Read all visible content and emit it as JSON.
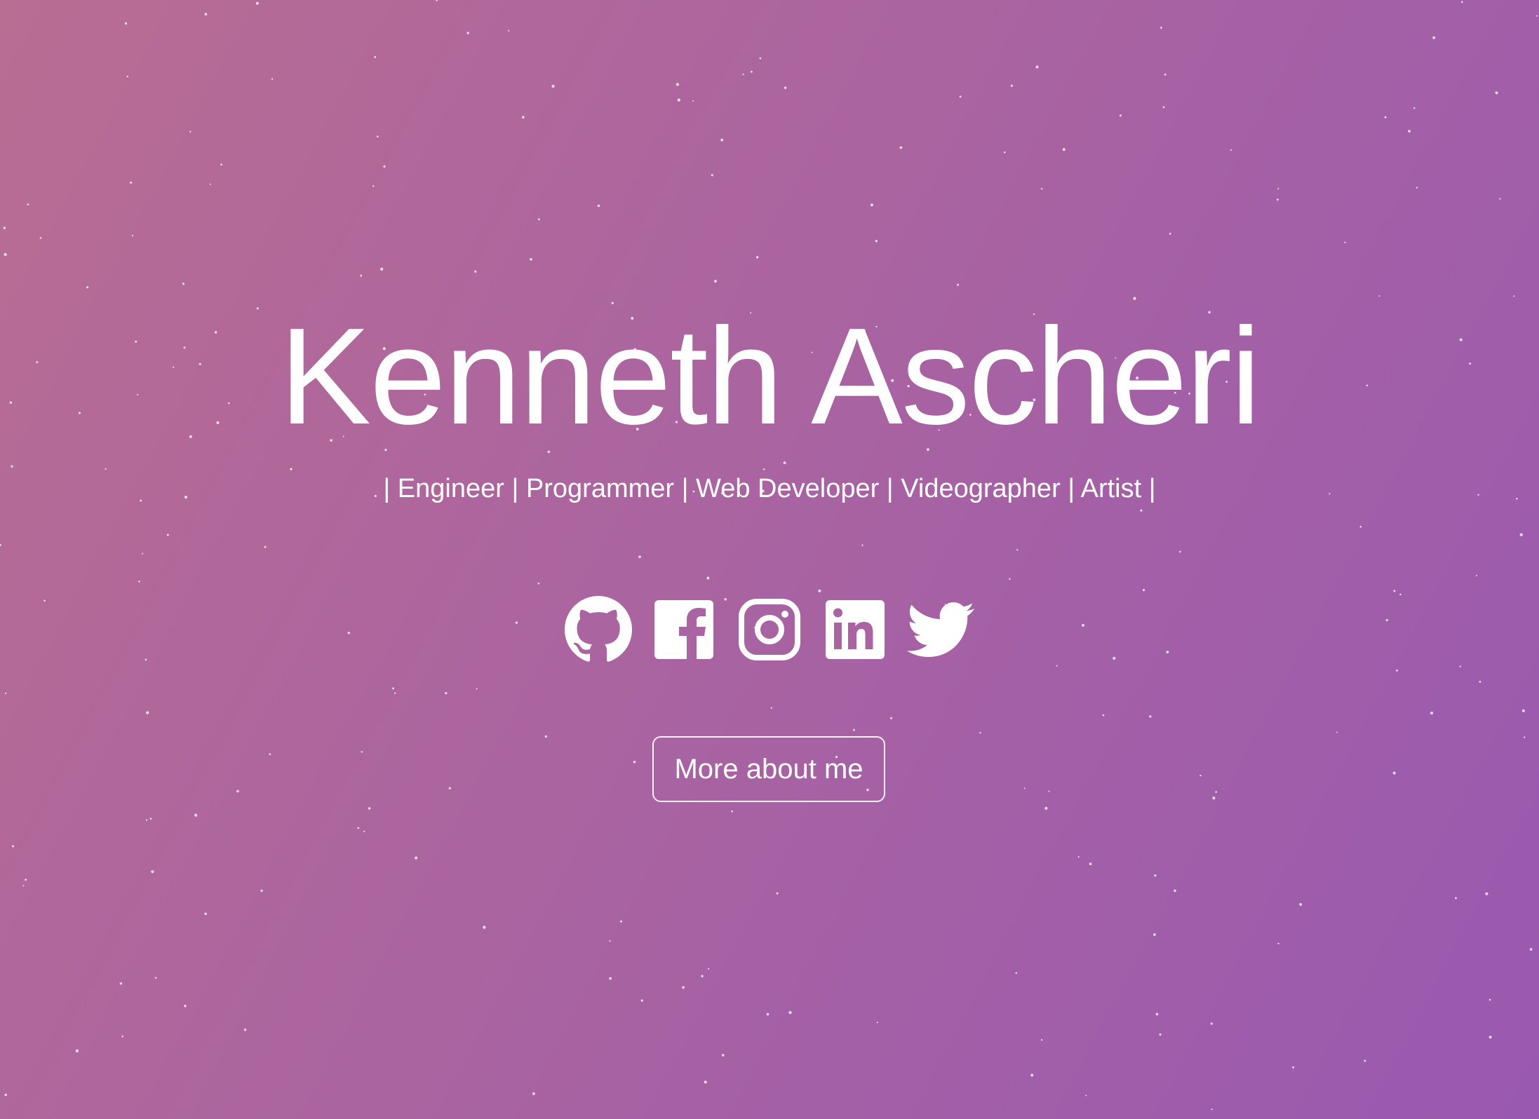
{
  "hero": {
    "name": "Kenneth Ascheri",
    "tagline": "| Engineer | Programmer | Web Developer | Videographer | Artist |"
  },
  "socials": [
    {
      "icon": "github-icon"
    },
    {
      "icon": "facebook-icon"
    },
    {
      "icon": "instagram-icon"
    },
    {
      "icon": "linkedin-icon"
    },
    {
      "icon": "twitter-icon"
    }
  ],
  "cta": {
    "label": "More about me"
  },
  "colors": {
    "gradient_start": "#b86d93",
    "gradient_mid": "#aa64a0",
    "gradient_end": "#9a59b0",
    "text": "#ffffff"
  }
}
